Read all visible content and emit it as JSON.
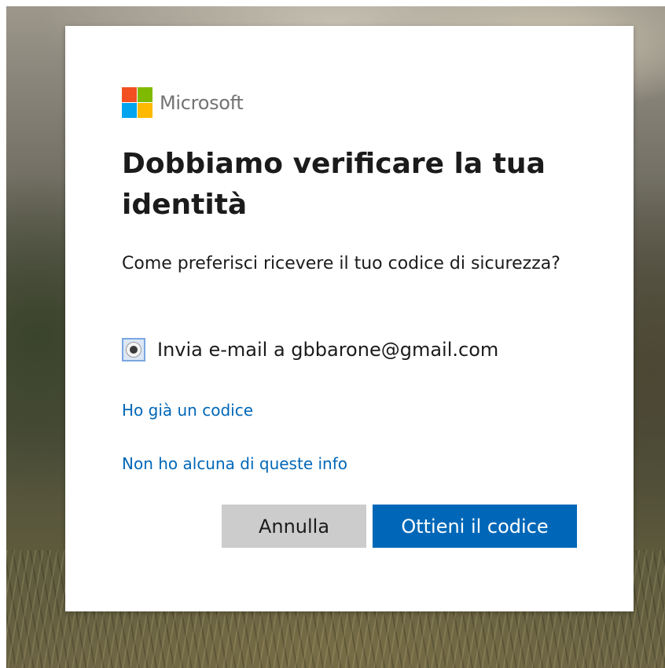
{
  "brand": {
    "name": "Microsoft",
    "colors": [
      "#f25022",
      "#7fba00",
      "#00a4ef",
      "#ffb900"
    ]
  },
  "dialog": {
    "title": "Dobbiamo verificare la tua identità",
    "subtitle": "Come preferisci ricevere il tuo codice di sicurezza?",
    "option": {
      "label": "Invia e-mail a gbbarone@gmail.com",
      "selected": true
    },
    "links": {
      "have_code": "Ho già un codice",
      "no_info": "Non ho alcuna di queste info"
    },
    "buttons": {
      "cancel": "Annulla",
      "submit": "Ottieni il codice"
    }
  },
  "colors": {
    "accent": "#0067b8",
    "cancel_bg": "#cccccc"
  }
}
